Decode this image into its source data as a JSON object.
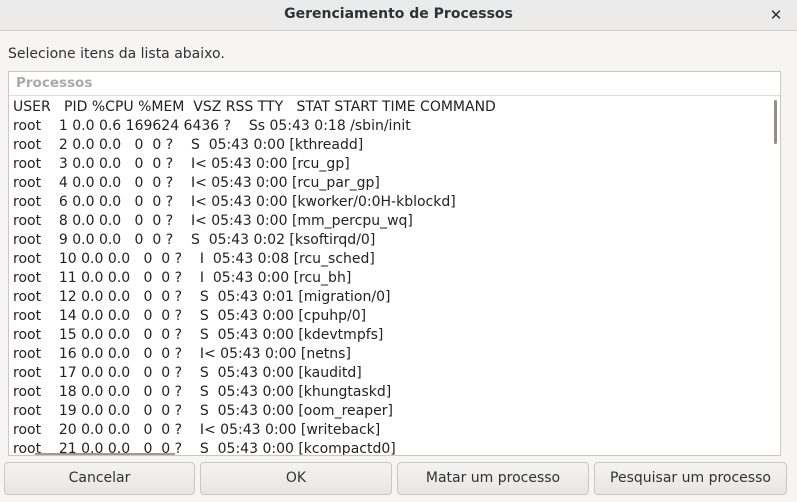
{
  "window": {
    "title": "Gerenciamento de Processos",
    "close_glyph": "✕"
  },
  "instruction": "Selecione itens da lista abaixo.",
  "frame": {
    "label": "Processos"
  },
  "process_lines": [
    "USER       PID %CPU %MEM    VSZ   RSS TTY      STAT START   TIME COMMAND",
    "root         1  0.0  0.6 169624  6436 ?        Ss   05:43   0:18 /sbin/init",
    "root         2  0.0  0.0      0     0 ?        S    05:43   0:00 [kthreadd]",
    "root         3  0.0  0.0      0     0 ?        I<   05:43   0:00 [rcu_gp]",
    "root         4  0.0  0.0      0     0 ?        I<   05:43   0:00 [rcu_par_gp]",
    "root         6  0.0  0.0      0     0 ?        I<   05:43   0:00 [kworker/0:0H-kblockd]",
    "root         8  0.0  0.0      0     0 ?        I<   05:43   0:00 [mm_percpu_wq]",
    "root         9  0.0  0.0      0     0 ?        S    05:43   0:02 [ksoftirqd/0]",
    "root        10  0.0  0.0      0     0 ?        I    05:43   0:08 [rcu_sched]",
    "root        11  0.0  0.0      0     0 ?        I    05:43   0:00 [rcu_bh]",
    "root        12  0.0  0.0      0     0 ?        S    05:43   0:01 [migration/0]",
    "root        14  0.0  0.0      0     0 ?        S    05:43   0:00 [cpuhp/0]",
    "root        15  0.0  0.0      0     0 ?        S    05:43   0:00 [kdevtmpfs]",
    "root        16  0.0  0.0      0     0 ?        I<   05:43   0:00 [netns]",
    "root        17  0.0  0.0      0     0 ?        S    05:43   0:00 [kauditd]",
    "root        18  0.0  0.0      0     0 ?        S    05:43   0:00 [khungtaskd]",
    "root        19  0.0  0.0      0     0 ?        S    05:43   0:00 [oom_reaper]",
    "root        20  0.0  0.0      0     0 ?        I<   05:43   0:00 [writeback]",
    "root        21  0.0  0.0      0     0 ?        S    05:43   0:00 [kcompactd0]"
  ],
  "buttons": {
    "cancel": "Cancelar",
    "ok": "OK",
    "kill": "Matar um processo",
    "search": "Pesquisar um processo"
  }
}
